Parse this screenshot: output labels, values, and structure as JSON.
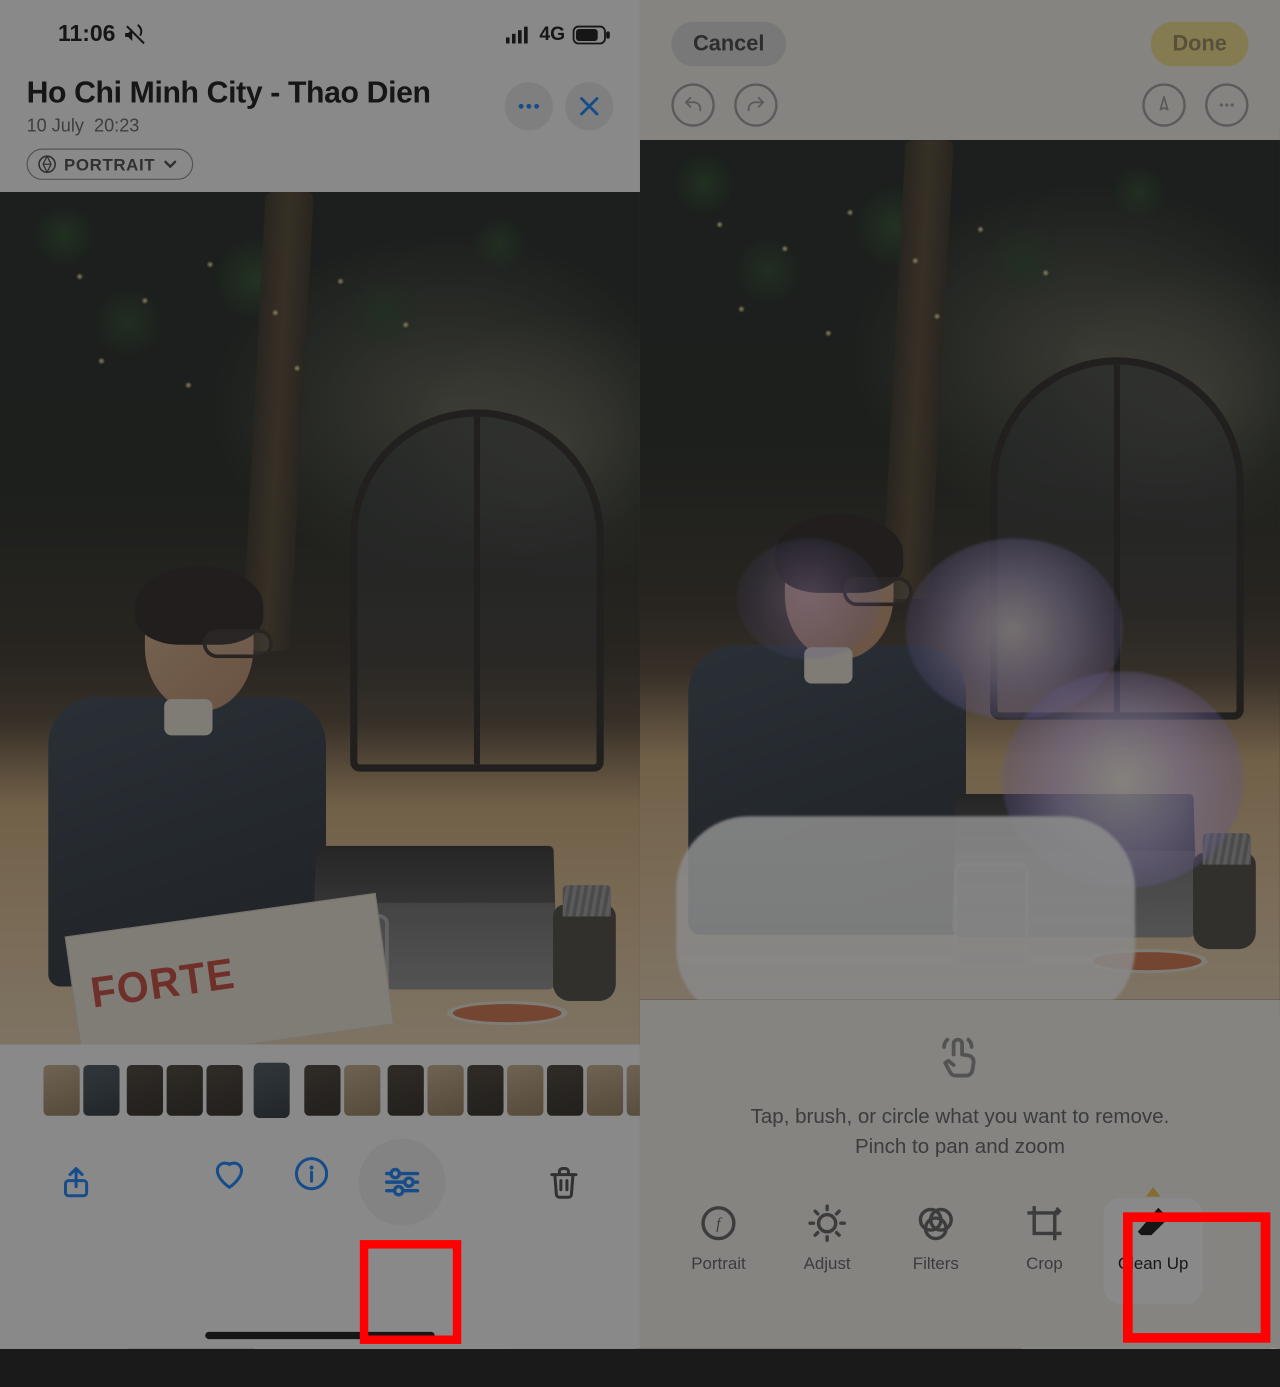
{
  "left": {
    "statusbar": {
      "time": "11:06",
      "carrier": "4G"
    },
    "header": {
      "title": "Ho Chi Minh City - Thao Dien",
      "date": "10 July",
      "time": "20:23",
      "badge": "PORTRAIT"
    },
    "photo": {
      "magazine_label": "FORTE"
    }
  },
  "right": {
    "editbar": {
      "cancel": "Cancel",
      "done": "Done"
    },
    "hint": {
      "line1": "Tap, brush, or circle what you want to remove.",
      "line2": "Pinch to pan and zoom"
    },
    "tools": {
      "portrait": "Portrait",
      "adjust": "Adjust",
      "filters": "Filters",
      "crop": "Crop",
      "cleanup": "Clean Up"
    }
  }
}
